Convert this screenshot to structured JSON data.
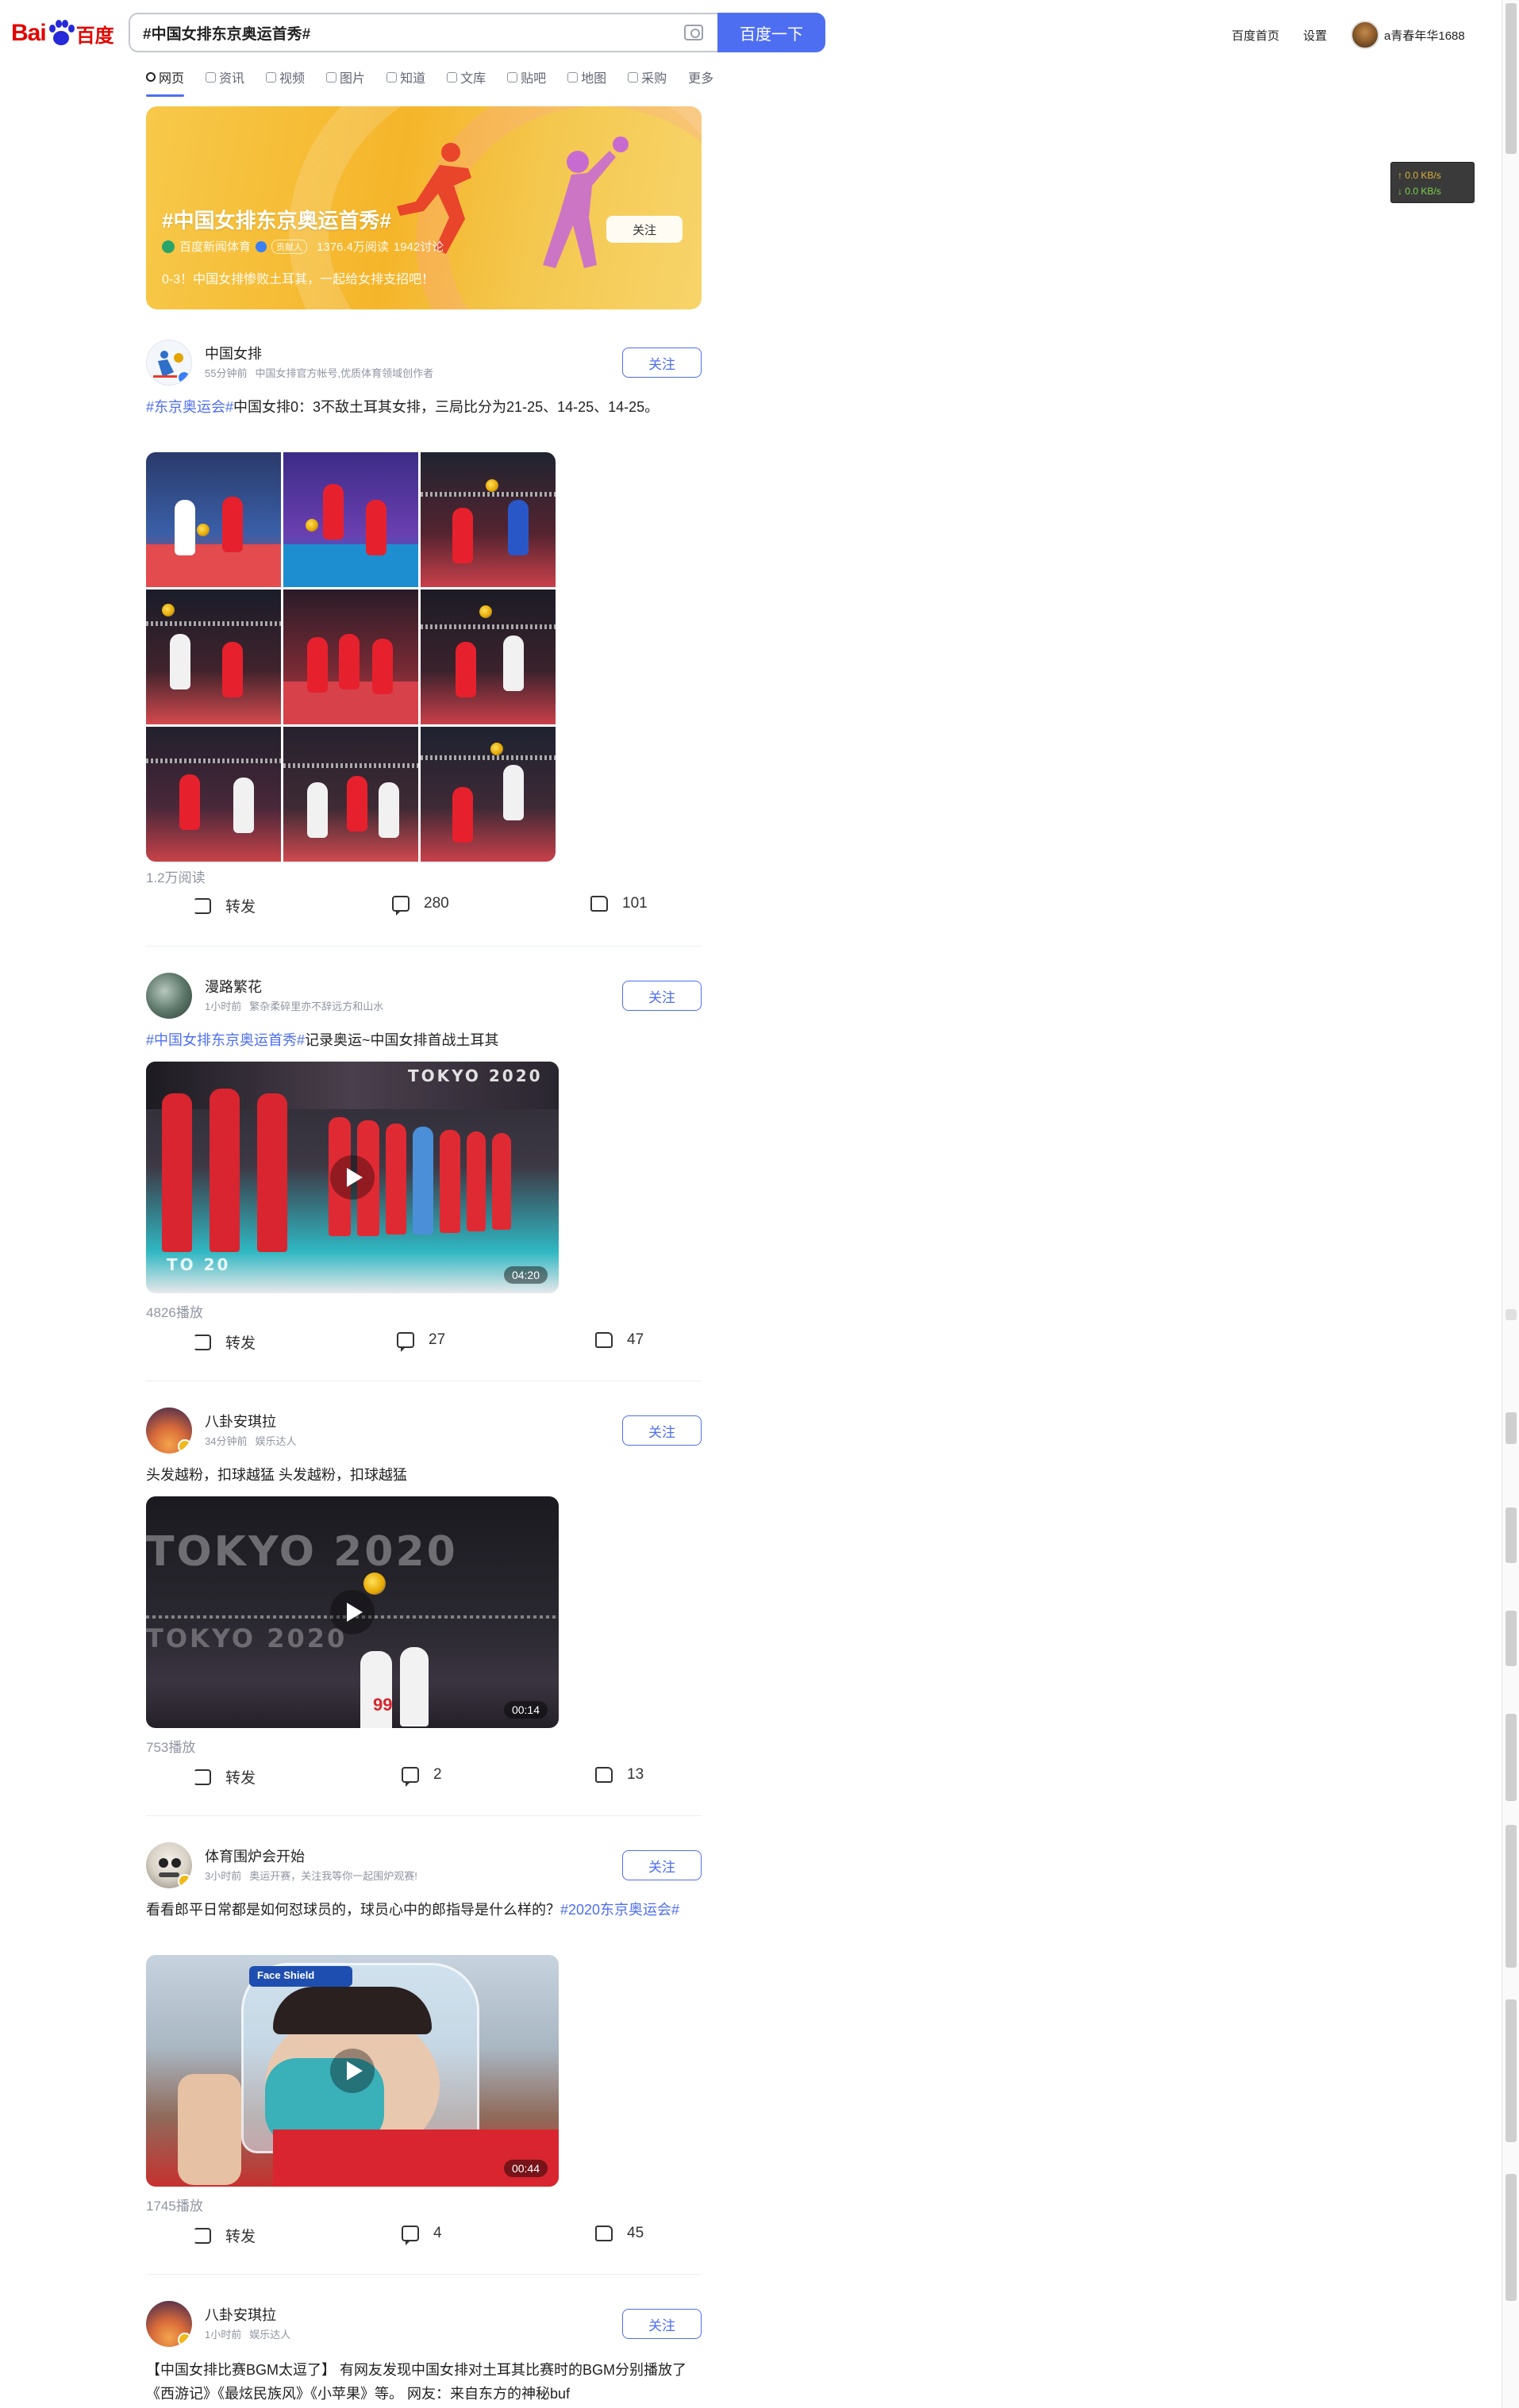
{
  "header": {
    "logo_left": "Bai",
    "logo_right": "百度",
    "search_value": "#中国女排东京奥运首秀#",
    "search_button": "百度一下",
    "links": [
      "百度首页",
      "设置"
    ],
    "username": "a青春年华1688"
  },
  "tabs": [
    {
      "label": "网页",
      "active": true
    },
    {
      "label": "资讯"
    },
    {
      "label": "视频"
    },
    {
      "label": "图片"
    },
    {
      "label": "知道"
    },
    {
      "label": "文库"
    },
    {
      "label": "贴吧"
    },
    {
      "label": "地图"
    },
    {
      "label": "采购"
    },
    {
      "label": "更多"
    }
  ],
  "net_widget": {
    "up": "↑ 0.0 KB/s",
    "down": "↓ 0.0 KB/s"
  },
  "banner": {
    "title": "#中国女排东京奥运首秀#",
    "source": "百度新闻体育",
    "badge": "贡献人",
    "reads": "1376.4万阅读",
    "discussions": "1942讨论",
    "description": "0-3！中国女排惨败土耳其，一起给女排支招吧！",
    "follow": "关注"
  },
  "posts": [
    {
      "author": "中国女排",
      "time": "55分钟前",
      "desc": "中国女排官方帐号,优质体育领域创作者",
      "follow": "关注",
      "tag": "#东京奥运会#",
      "text": "中国女排0：3不敌土耳其女排，三局比分为21-25、14-25、14-25。",
      "stats": "1.2万阅读",
      "repost": "转发",
      "comments": "280",
      "likes": "101"
    },
    {
      "author": "漫路繁花",
      "time": "1小时前",
      "desc": "繁杂柔碎里亦不辞远方和山水",
      "follow": "关注",
      "tag": "#中国女排东京奥运首秀#",
      "text": "记录奥运~中国女排首战土耳其",
      "duration": "04:20",
      "stats": "4826播放",
      "repost": "转发",
      "comments": "27",
      "likes": "47"
    },
    {
      "author": "八卦安琪拉",
      "time": "34分钟前",
      "desc": "娱乐达人",
      "follow": "关注",
      "text": "头发越粉，扣球越猛 头发越粉，扣球越猛",
      "duration": "00:14",
      "stats": "753播放",
      "repost": "转发",
      "comments": "2",
      "likes": "13"
    },
    {
      "author": "体育围炉会开始",
      "time": "3小时前",
      "desc": "奥运开赛，关注我等你一起围炉观赛!",
      "follow": "关注",
      "text": "看看郎平日常都是如何怼球员的，球员心中的郎指导是什么样的？",
      "tag": "#2020东京奥运会#",
      "duration": "00:44",
      "stats": "1745播放",
      "repost": "转发",
      "comments": "4",
      "likes": "45"
    },
    {
      "author": "八卦安琪拉",
      "time": "1小时前",
      "desc": "娱乐达人",
      "follow": "关注",
      "text": "【中国女排比赛BGM太逗了】 有网友发现中国女排对土耳其比赛时的BGM分别播放了《西游记》《最炫民族风》《小苹果》等。 网友：来自东方的神秘buf"
    }
  ]
}
